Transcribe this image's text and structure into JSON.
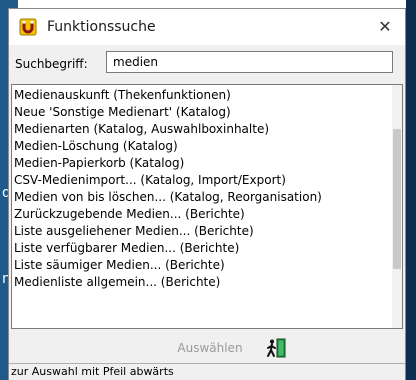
{
  "background_fragments": [
    "d",
    "n"
  ],
  "window": {
    "title": "Funktionssuche",
    "close_glyph": "✕",
    "icon": "horseshoe-magnet-icon"
  },
  "search": {
    "label": "Suchbegriff:",
    "value": "medien"
  },
  "results": [
    "Medienauskunft  (Thekenfunktionen)",
    "Neue 'Sonstige Medienart'  (Katalog)",
    "Medienarten  (Katalog, Auswahlboxinhalte)",
    "Medien-Löschung  (Katalog)",
    "Medien-Papierkorb  (Katalog)",
    "CSV-Medienimport...  (Katalog, Import/Export)",
    "Medien von bis löschen...  (Katalog, Reorganisation)",
    "Zurückzugebende Medien...  (Berichte)",
    "Liste ausgeliehener Medien...  (Berichte)",
    "Liste verfügbarer Medien...  (Berichte)",
    "Liste säumiger Medien...  (Berichte)",
    "Medienliste allgemein...  (Berichte)"
  ],
  "buttons": {
    "select_label": "Auswählen",
    "exit_icon": "exit-door-icon"
  },
  "status": "zur Auswahl mit Pfeil abwärts",
  "colors": {
    "accent_red": "#d0212a",
    "accent_yellow": "#f5c400",
    "background_blue": "#1f5a8a"
  }
}
